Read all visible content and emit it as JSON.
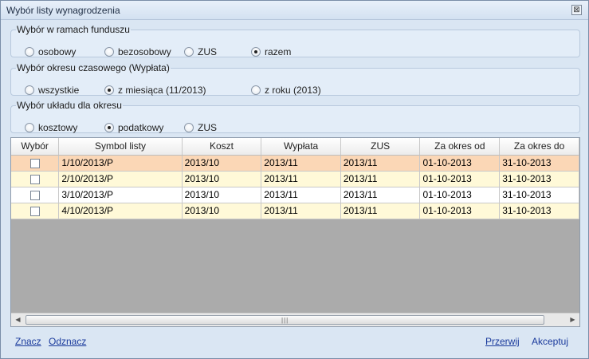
{
  "window": {
    "title": "Wybór listy wynagrodzenia",
    "close_glyph": "⊠"
  },
  "fund_group": {
    "legend": "Wybór w ramach funduszu",
    "options": [
      {
        "label": "osobowy",
        "selected": false
      },
      {
        "label": "bezosobowy",
        "selected": false
      },
      {
        "label": "ZUS",
        "selected": false
      },
      {
        "label": "razem",
        "selected": true
      }
    ]
  },
  "period_group": {
    "legend": "Wybór okresu czasowego (Wypłata)",
    "options": [
      {
        "label": "wszystkie",
        "selected": false
      },
      {
        "label": "z miesiąca (11/2013)",
        "selected": true
      },
      {
        "label": "z roku (2013)",
        "selected": false
      }
    ]
  },
  "layout_group": {
    "legend": "Wybór układu dla okresu",
    "options": [
      {
        "label": "kosztowy",
        "selected": false
      },
      {
        "label": "podatkowy",
        "selected": true
      },
      {
        "label": "ZUS",
        "selected": false
      }
    ]
  },
  "grid": {
    "columns": [
      "Wybór",
      "Symbol listy",
      "Koszt",
      "Wypłata",
      "ZUS",
      "Za okres od",
      "Za okres do"
    ],
    "rows": [
      {
        "symbol": "1/10/2013/P",
        "koszt": "2013/10",
        "wyplata": "2013/11",
        "zus": "2013/11",
        "od": "01-10-2013",
        "do": "31-10-2013",
        "checked": false
      },
      {
        "symbol": "2/10/2013/P",
        "koszt": "2013/10",
        "wyplata": "2013/11",
        "zus": "2013/11",
        "od": "01-10-2013",
        "do": "31-10-2013",
        "checked": false
      },
      {
        "symbol": "3/10/2013/P",
        "koszt": "2013/10",
        "wyplata": "2013/11",
        "zus": "2013/11",
        "od": "01-10-2013",
        "do": "31-10-2013",
        "checked": false
      },
      {
        "symbol": "4/10/2013/P",
        "koszt": "2013/10",
        "wyplata": "2013/11",
        "zus": "2013/11",
        "od": "01-10-2013",
        "do": "31-10-2013",
        "checked": false
      }
    ],
    "scroll_left": "◀",
    "scroll_right": "▶",
    "scroll_grip": "|||"
  },
  "footer": {
    "znacz": "Znacz",
    "odznacz": "Odznacz",
    "przerwij": "Przerwij",
    "akceptuj": "Akceptuj"
  }
}
